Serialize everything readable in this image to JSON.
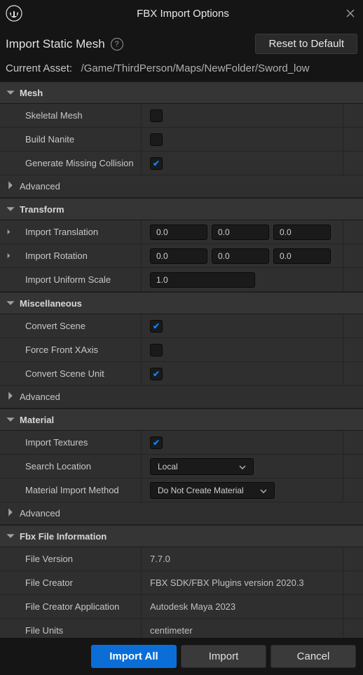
{
  "window": {
    "title": "FBX Import Options",
    "subtitle": "Import Static Mesh",
    "reset_button": "Reset to Default",
    "asset_label": "Current Asset:",
    "asset_path": "/Game/ThirdPerson/Maps/NewFolder/Sword_low"
  },
  "sections": {
    "mesh": {
      "title": "Mesh",
      "skeletal_mesh": "Skeletal Mesh",
      "build_nanite": "Build Nanite",
      "generate_collision": "Generate Missing Collision",
      "advanced": "Advanced"
    },
    "transform": {
      "title": "Transform",
      "import_translation": "Import Translation",
      "translation_x": "0.0",
      "translation_y": "0.0",
      "translation_z": "0.0",
      "import_rotation": "Import Rotation",
      "rotation_x": "0.0",
      "rotation_y": "0.0",
      "rotation_z": "0.0",
      "import_scale": "Import Uniform Scale",
      "scale_value": "1.0"
    },
    "misc": {
      "title": "Miscellaneous",
      "convert_scene": "Convert Scene",
      "force_front": "Force Front XAxis",
      "convert_unit": "Convert Scene Unit",
      "advanced": "Advanced"
    },
    "material": {
      "title": "Material",
      "import_textures": "Import Textures",
      "search_location": "Search Location",
      "search_location_value": "Local",
      "import_method": "Material Import Method",
      "import_method_value": "Do Not Create Material",
      "advanced": "Advanced"
    },
    "fbx": {
      "title": "Fbx File Information",
      "file_version": "File Version",
      "file_version_value": "7.7.0",
      "file_creator": "File Creator",
      "file_creator_value": "FBX SDK/FBX Plugins version 2020.3",
      "file_app": "File Creator Application",
      "file_app_value": "Autodesk Maya 2023",
      "file_units": "File Units",
      "file_units_value": "centimeter"
    }
  },
  "footer": {
    "import_all": "Import All",
    "import": "Import",
    "cancel": "Cancel"
  }
}
